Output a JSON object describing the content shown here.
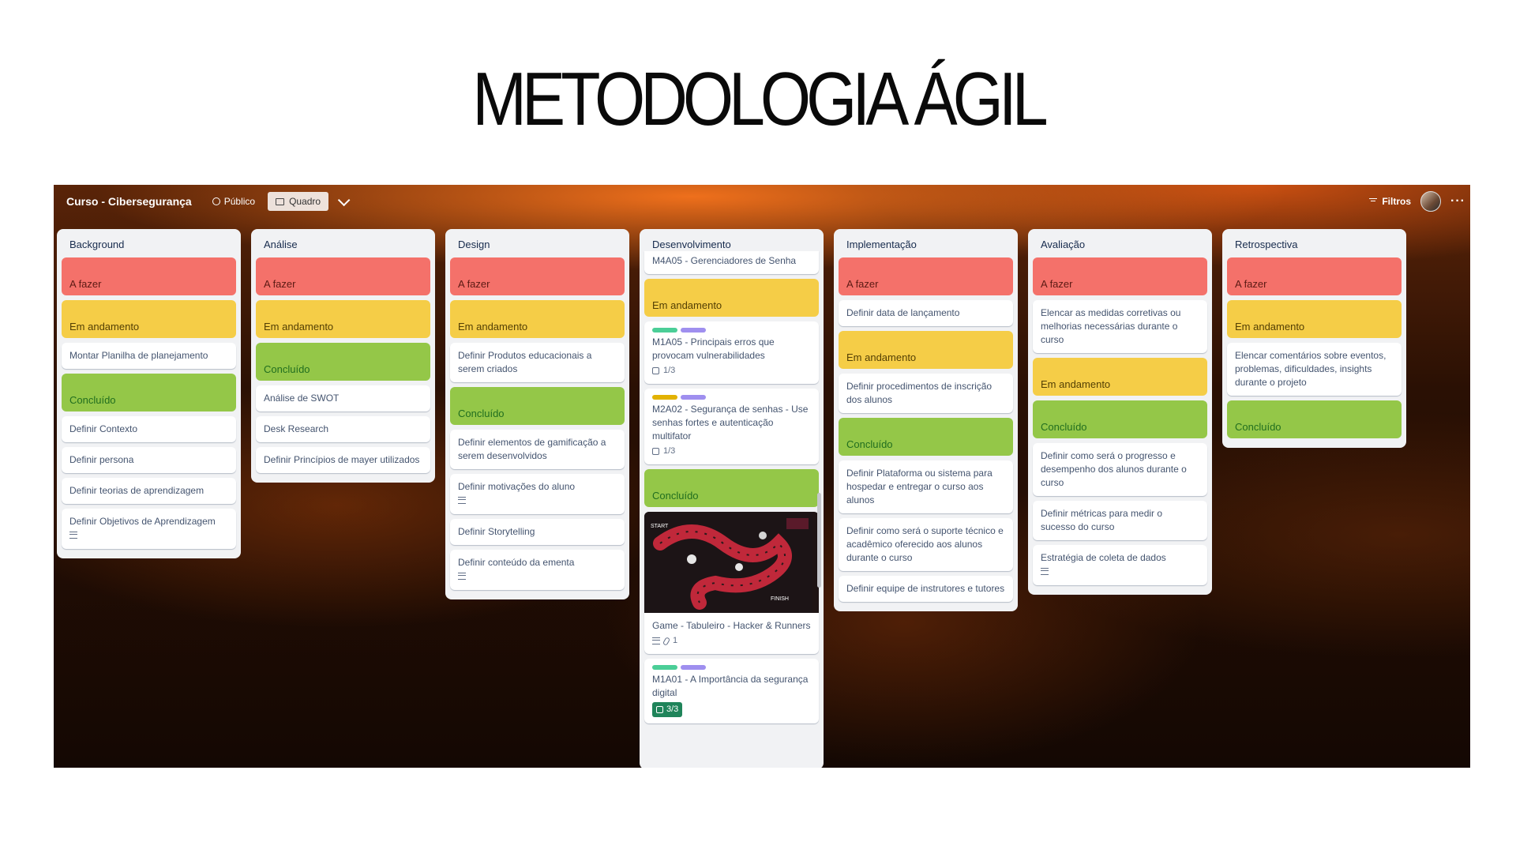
{
  "slide_title": "METODOLOGIA ÁGIL",
  "board": {
    "name": "Curso - Cibersegurança",
    "visibility": "Público",
    "view": "Quadro",
    "filter_label": "Filtros",
    "more": "···"
  },
  "colors": {
    "todo": "#f4716a",
    "doing": "#f5cd47",
    "done": "#94c748"
  },
  "lists": {
    "background": {
      "title": "Background",
      "todo": "A fazer",
      "doing": "Em andamento",
      "doing_cards": [
        "Montar Planilha de planejamento"
      ],
      "done": "Concluído",
      "done_cards": [
        "Definir Contexto",
        "Definir persona",
        "Definir teorias de aprendizagem",
        "Definir Objetivos de Aprendizagem"
      ]
    },
    "analise": {
      "title": "Análise",
      "todo": "A fazer",
      "doing": "Em andamento",
      "done": "Concluído",
      "done_cards": [
        "Análise de SWOT",
        "Desk Research",
        "Definir Princípios de mayer utilizados"
      ]
    },
    "design": {
      "title": "Design",
      "todo": "A fazer",
      "doing": "Em andamento",
      "doing_cards": [
        "Definir Produtos educacionais a serem criados"
      ],
      "done": "Concluído",
      "done_cards": [
        "Definir elementos de gamificação a serem desenvolvidos",
        "Definir motivações do aluno",
        "Definir Storytelling",
        "Definir conteúdo da ementa"
      ]
    },
    "desenvolvimento": {
      "title": "Desenvolvimento",
      "top_card": "M4A05 - Gerenciadores de Senha",
      "doing": "Em andamento",
      "doing_cards": [
        {
          "text": "M1A05 - Principais erros que provocam vulnerabilidades",
          "check": "1/3"
        },
        {
          "text": "M2A02 - Segurança de senhas - Use senhas fortes e autenticação multifator",
          "check": "1/3"
        }
      ],
      "done": "Concluído",
      "game_card": {
        "text": "Game - Tabuleiro - Hacker & Runners",
        "attachments": "1",
        "cover_start": "START",
        "cover_finish": "FINISH"
      },
      "last_card": {
        "text": "M1A01 - A Importância da segurança digital",
        "check": "3/3"
      },
      "label_colors": {
        "green": "#4bce97",
        "purple": "#9f8fef",
        "yellow": "#e2b203"
      }
    },
    "implementacao": {
      "title": "Implementação",
      "todo": "A fazer",
      "todo_cards": [
        "Definir data de lançamento"
      ],
      "doing": "Em andamento",
      "doing_cards": [
        "Definir procedimentos de inscrição dos alunos"
      ],
      "done": "Concluído",
      "done_cards": [
        "Definir Plataforma ou sistema para hospedar e entregar o curso aos alunos",
        "Definir como será o suporte técnico e acadêmico oferecido aos alunos durante o curso",
        "Definir equipe de instrutores e tutores"
      ]
    },
    "avaliacao": {
      "title": "Avaliação",
      "todo": "A fazer",
      "todo_cards": [
        "Elencar as medidas corretivas ou melhorias necessárias durante o curso"
      ],
      "doing": "Em andamento",
      "done": "Concluído",
      "done_cards": [
        "Definir como será o progresso e desempenho dos alunos durante o curso",
        "Definir métricas para medir o sucesso do curso",
        "Estratégia de coleta de dados"
      ]
    },
    "retrospectiva": {
      "title": "Retrospectiva",
      "todo": "A fazer",
      "doing": "Em andamento",
      "doing_cards": [
        "Elencar comentários sobre eventos, problemas, dificuldades, insights durante o projeto"
      ],
      "done": "Concluído"
    }
  }
}
